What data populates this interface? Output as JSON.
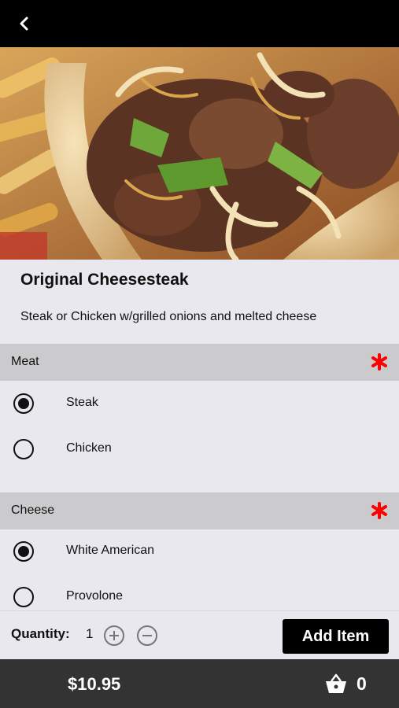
{
  "header": {
    "back_icon": "chevron-left-icon"
  },
  "item": {
    "title": "Original Cheesesteak",
    "description": "Steak or Chicken w/grilled onions and melted cheese"
  },
  "sections": [
    {
      "label": "Meat",
      "required": true,
      "options": [
        {
          "label": "Steak",
          "selected": true
        },
        {
          "label": "Chicken",
          "selected": false
        }
      ]
    },
    {
      "label": "Cheese",
      "required": true,
      "options": [
        {
          "label": "White American",
          "selected": true
        },
        {
          "label": "Provolone",
          "selected": false
        }
      ]
    }
  ],
  "quantity": {
    "label": "Quantity:",
    "value": "1"
  },
  "actions": {
    "add_label": "Add Item"
  },
  "footer": {
    "total": "$10.95",
    "cart_count": "0",
    "cart_icon": "basket-icon"
  },
  "colors": {
    "required_asterisk": "#ff0000",
    "bottom_bar": "#333333",
    "top_bar": "#000000",
    "section_header": "#cbcbcd"
  }
}
